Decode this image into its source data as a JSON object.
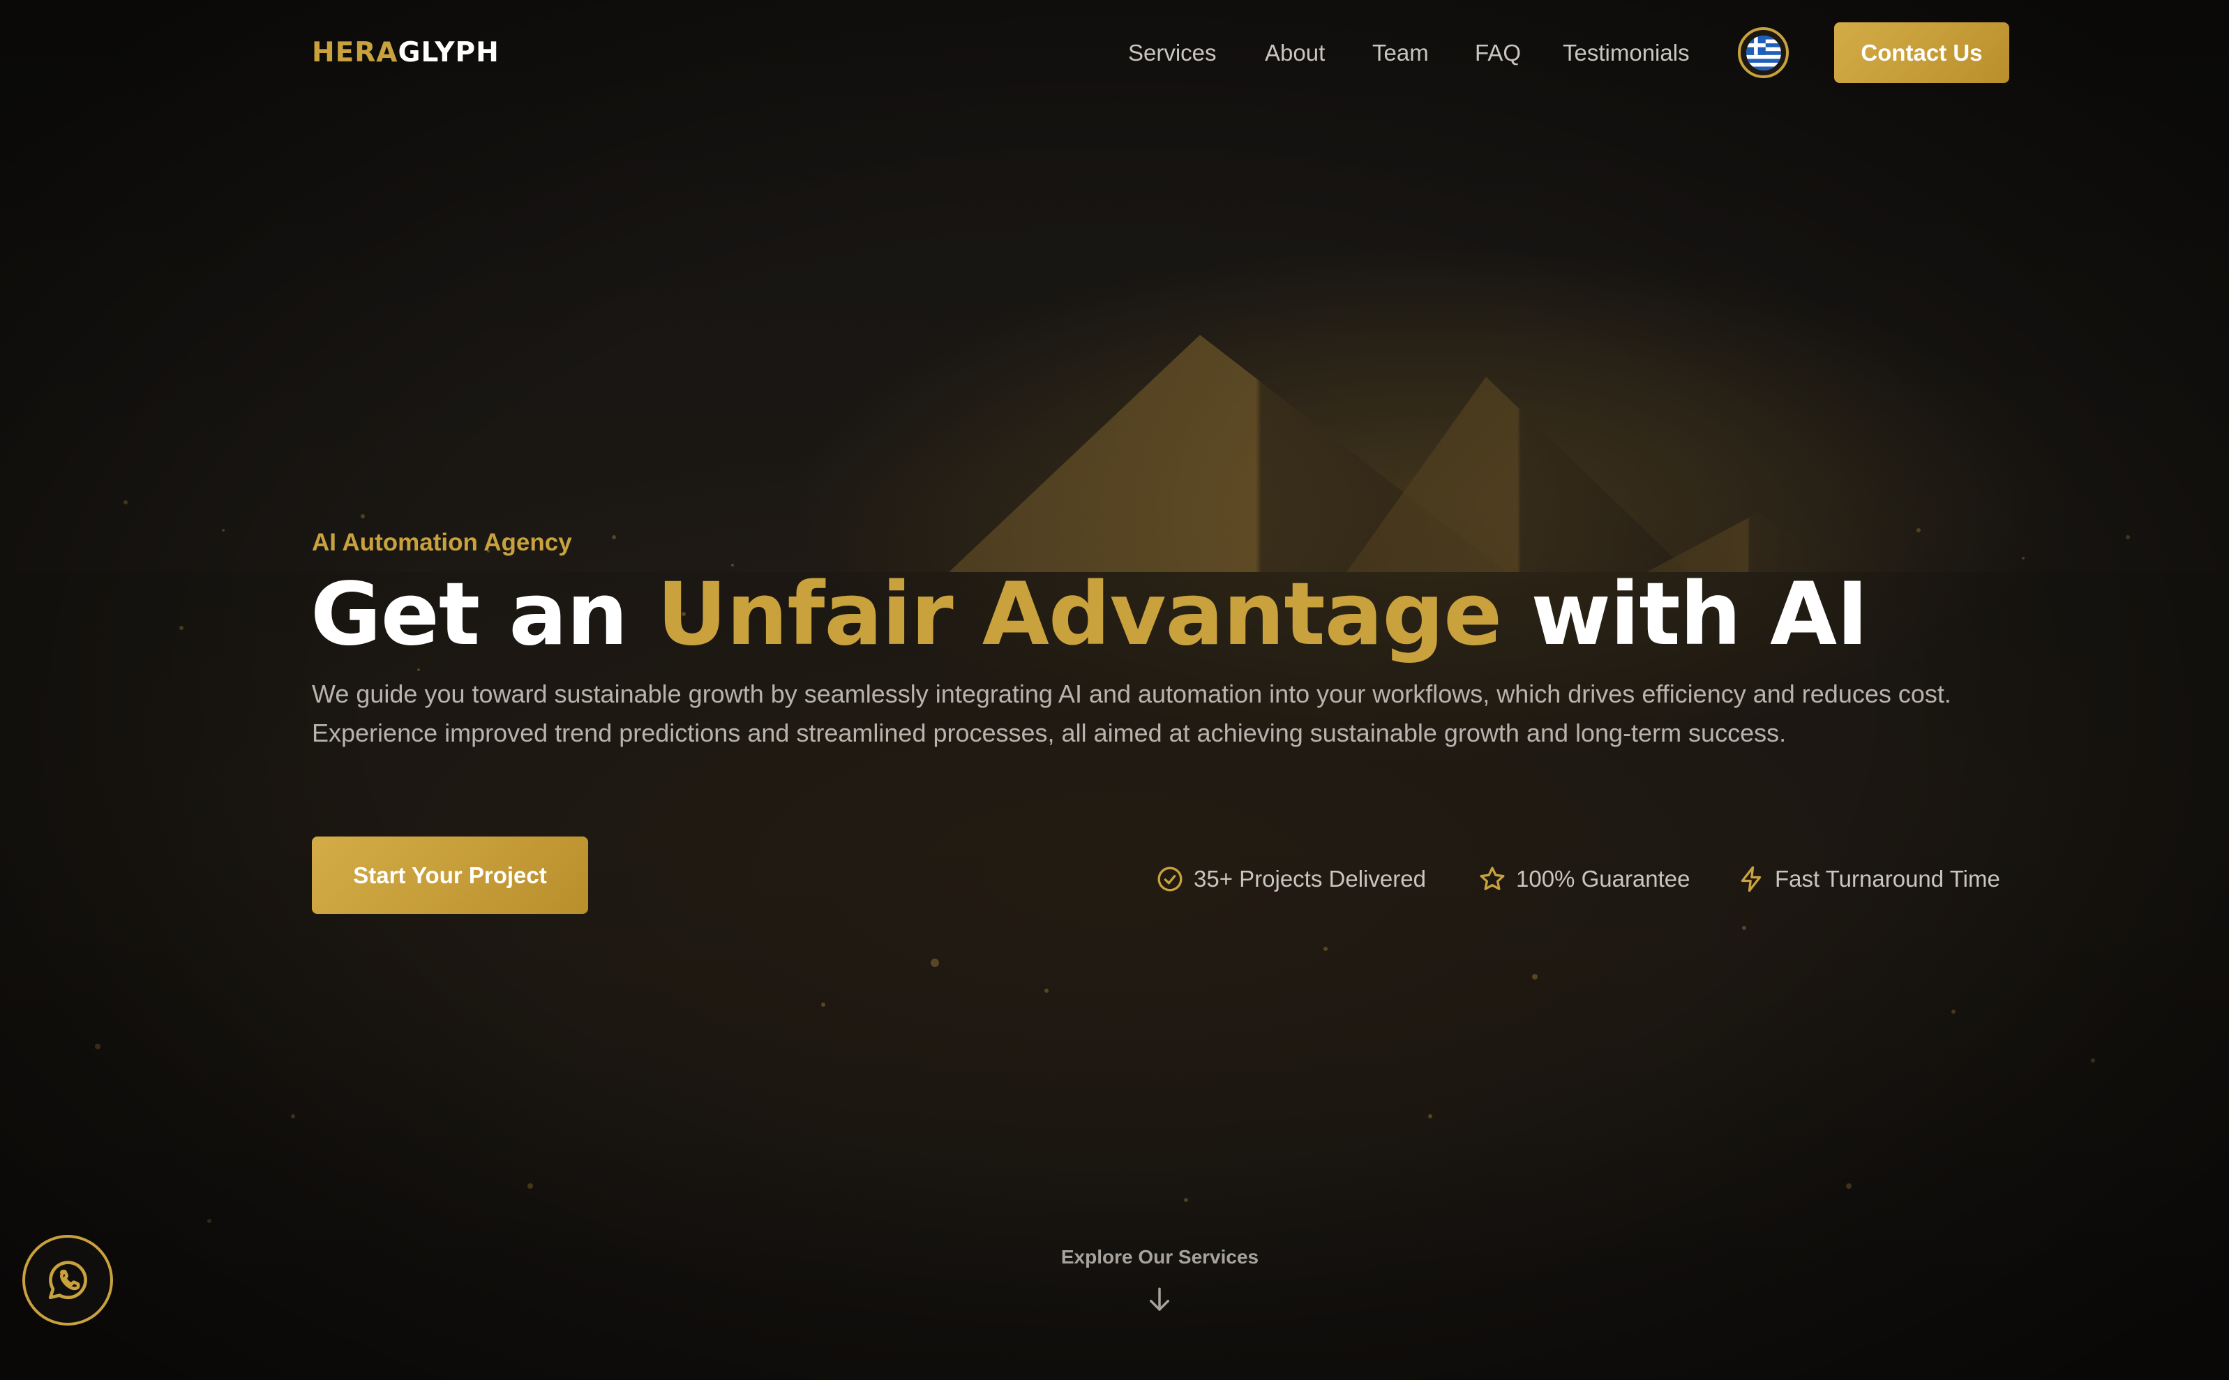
{
  "brand": {
    "part1": "HERA",
    "part2": "GLYPH"
  },
  "nav": {
    "links": [
      "Services",
      "About",
      "Team",
      "FAQ",
      "Testimonials"
    ],
    "language_icon": "greece-flag-icon",
    "contact_label": "Contact Us"
  },
  "hero": {
    "eyebrow": "AI Automation Agency",
    "headline_part1": "Get an ",
    "headline_highlight": "Unfair Advantage",
    "headline_part2": " with AI",
    "lead": "We guide you toward sustainable growth by seamlessly integrating AI and automation into your workflows, which drives efficiency and reduces cost. Experience improved trend predictions and streamlined processes, all aimed at achieving sustainable growth and long-term success.",
    "cta_label": "Start Your Project",
    "features": [
      {
        "icon": "check-circle-icon",
        "label": "35+ Projects Delivered"
      },
      {
        "icon": "star-icon",
        "label": "100% Guarantee"
      },
      {
        "icon": "lightning-icon",
        "label": "Fast Turnaround Time"
      }
    ]
  },
  "explore": {
    "label": "Explore Our Services",
    "icon": "arrow-down-icon"
  },
  "floating": {
    "icon": "whatsapp-icon"
  },
  "colors": {
    "accent": "#c9a23e",
    "background": "#141210",
    "text_muted": "#c9c6c0"
  }
}
